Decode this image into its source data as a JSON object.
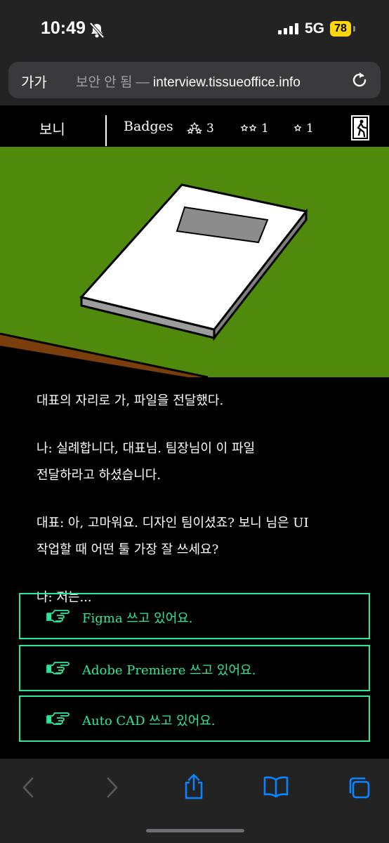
{
  "status_bar": {
    "time": "10:49",
    "network": "5G",
    "battery": "78"
  },
  "browser": {
    "aa_label": "가가",
    "url_prefix": "보안 안 됨 — ",
    "url_host": "interview.tissueoffice.info"
  },
  "game_header": {
    "player_name": "보니",
    "badges_label": "Badges",
    "badges": [
      {
        "icon": "three-stars-icon",
        "count": "3"
      },
      {
        "icon": "two-stars-icon",
        "count": "1"
      },
      {
        "icon": "one-star-icon",
        "count": "1"
      }
    ]
  },
  "dialogue": [
    "대표의 자리로 가, 파일을 전달했다.",
    "나: 실례합니다, 대표님. 팀장님이 이 파일\n전달하라고 하셨습니다.",
    "대표: 아, 고마워요. 디자인 팀이셨죠? 보니 님은 UI\n작업할 때 어떤 툴 가장 잘 쓰세요?",
    "나: 저는..."
  ],
  "choices": [
    {
      "label": "Figma 쓰고 있어요."
    },
    {
      "label": "Adobe Premiere 쓰고 있어요."
    },
    {
      "label": "Auto CAD 쓰고 있어요."
    }
  ],
  "colors": {
    "grass": "#4f8a0c",
    "choice_accent": "#2ee89a",
    "ios_blue": "#0a84ff",
    "toolbar_bg": "#232323",
    "battery": "#ffd60a"
  }
}
